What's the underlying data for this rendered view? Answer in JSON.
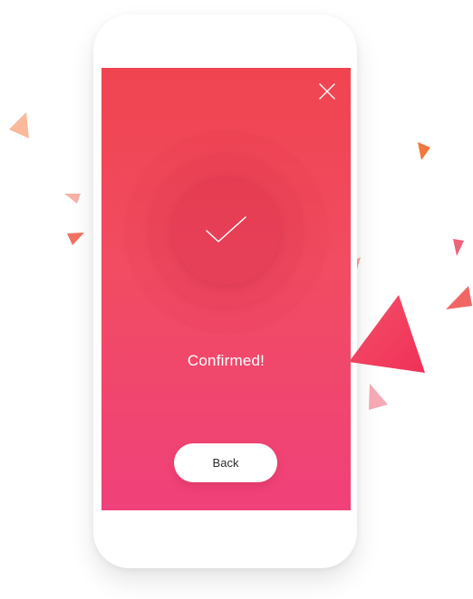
{
  "screen": {
    "status_text": "Confirmed!",
    "back_label": "Back"
  },
  "icons": {
    "close": "close-icon",
    "check": "checkmark-icon"
  },
  "colors": {
    "gradient_top": "#f04450",
    "gradient_bottom": "#f0417a",
    "button_bg": "#ffffff",
    "text_light": "#ffffff"
  }
}
